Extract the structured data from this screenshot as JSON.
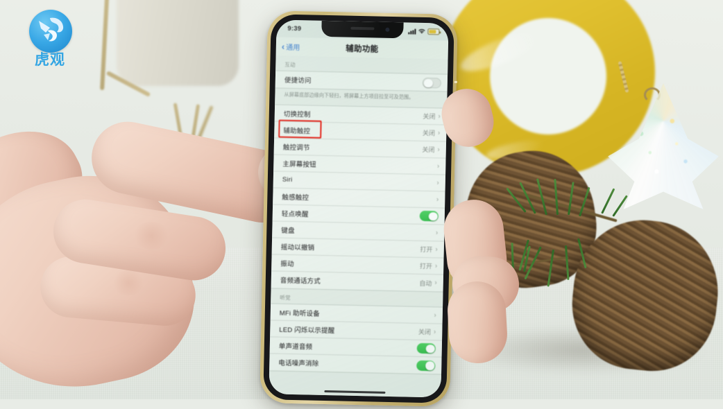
{
  "watermark": {
    "brand": "虎观",
    "logo_icon": "tiger-circle-logo",
    "color": "#33a5e3"
  },
  "device": {
    "model_hint": "iphone-x-style",
    "frame_color": "#cbb979",
    "status_bar": {
      "time": "9:39",
      "cellular_icon": "signal-bars-icon",
      "wifi_icon": "wifi-icon",
      "battery_icon": "battery-low-power-icon",
      "battery_color": "#e8c53c"
    },
    "nav": {
      "back_icon": "chevron-left-icon",
      "back_label": "通用",
      "title": "辅助功能",
      "tint": "#3a7fd5"
    }
  },
  "annotation": {
    "shape": "rectangle",
    "color": "#ee2016",
    "target": "辅助触控"
  },
  "screen": {
    "sections": [
      {
        "header": "互动",
        "rows": [
          {
            "label": "便捷访问",
            "control": "toggle",
            "state": "off"
          }
        ],
        "footer": "从屏幕底部边缘向下轻扫，将屏幕上方项目拉至可及范围。"
      },
      {
        "header": "",
        "rows": [
          {
            "label": "切换控制",
            "value": "关闭",
            "control": "chevron"
          },
          {
            "label": "辅助触控",
            "value": "关闭",
            "control": "chevron",
            "highlighted": true
          },
          {
            "label": "触控调节",
            "value": "关闭",
            "control": "chevron"
          },
          {
            "label": "主屏幕按钮",
            "value": "",
            "control": "chevron"
          },
          {
            "label": "Siri",
            "value": "",
            "control": "chevron"
          },
          {
            "label": "触感触控",
            "value": "",
            "control": "chevron"
          },
          {
            "label": "轻点唤醒",
            "control": "toggle",
            "state": "on"
          },
          {
            "label": "键盘",
            "value": "",
            "control": "chevron"
          },
          {
            "label": "摇动以撤销",
            "value": "打开",
            "control": "chevron"
          },
          {
            "label": "振动",
            "value": "打开",
            "control": "chevron"
          },
          {
            "label": "音频通话方式",
            "value": "自动",
            "control": "chevron"
          }
        ],
        "footer": ""
      },
      {
        "header": "听觉",
        "rows": [
          {
            "label": "MFi 助听设备",
            "value": "",
            "control": "chevron"
          },
          {
            "label": "LED 闪烁以示提醒",
            "value": "关闭",
            "control": "chevron"
          },
          {
            "label": "单声道音频",
            "control": "toggle",
            "state": "on"
          },
          {
            "label": "电话噪声消除",
            "control": "toggle",
            "state": "on"
          }
        ],
        "footer": ""
      }
    ]
  },
  "scene": {
    "objects": [
      "hand-holding-phone",
      "white-planter-pot",
      "gold-stand",
      "yellow-ring-decoration",
      "pine-cone",
      "pine-branch",
      "tinsel-star-ornament"
    ],
    "background_color": "#e6eae4"
  }
}
